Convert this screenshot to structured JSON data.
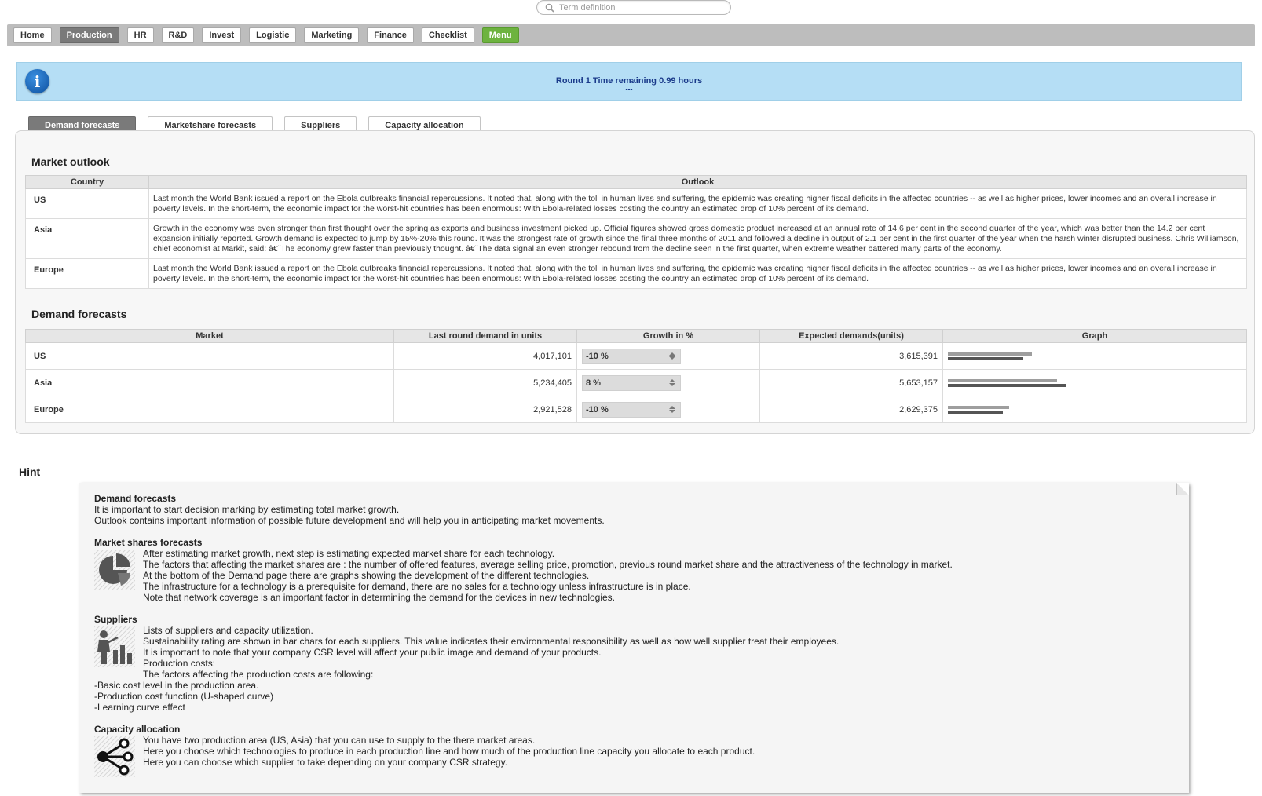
{
  "search": {
    "placeholder": "Term definition"
  },
  "nav": {
    "items": [
      "Home",
      "Production",
      "HR",
      "R&D",
      "Invest",
      "Logistic",
      "Marketing",
      "Finance",
      "Checklist",
      "Menu"
    ],
    "active": "Production"
  },
  "banner": {
    "text": "Round 1 Time remaining 0.99 hours",
    "sub": "---"
  },
  "tabs": [
    "Demand forecasts",
    "Marketshare forecasts",
    "Suppliers",
    "Capacity allocation"
  ],
  "outlook": {
    "title": "Market outlook",
    "headers": [
      "Country",
      "Outlook"
    ],
    "rows": [
      {
        "country": "US",
        "text": "Last month the World Bank issued a report on the Ebola outbreaks financial repercussions. It noted that, along with the toll in human lives and suffering, the epidemic was creating higher fiscal deficits in the affected countries -- as well as higher prices, lower incomes and an overall increase in poverty levels. In the short-term, the economic impact for the worst-hit countries has been enormous: With Ebola-related losses costing the country an estimated drop of 10% percent of its demand."
      },
      {
        "country": "Asia",
        "text": "Growth in the economy was even stronger than first thought over the spring as exports and business investment picked up. Official figures showed gross domestic product increased at an annual rate of 14.6 per cent in the second quarter of the year, which was better than the 14.2 per cent expansion initially reported. Growth demand is expected to jump by 15%-20% this round. It was the strongest rate of growth since the final three months of 2011 and followed a decline in output of 2.1 per cent in the first quarter of the year when the harsh winter disrupted business. Chris Williamson, chief economist at Markit, said: â€˜The economy grew faster than previously thought. â€˜The data signal an even stronger rebound from the decline seen in the first quarter, when extreme weather battered many parts of the economy."
      },
      {
        "country": "Europe",
        "text": "Last month the World Bank issued a report on the Ebola outbreaks financial repercussions. It noted that, along with the toll in human lives and suffering, the epidemic was creating higher fiscal deficits in the affected countries -- as well as higher prices, lower incomes and an overall increase in poverty levels. In the short-term, the economic impact for the worst-hit countries has been enormous: With Ebola-related losses costing the country an estimated drop of 10% percent of its demand."
      }
    ]
  },
  "demand": {
    "title": "Demand forecasts",
    "headers": [
      "Market",
      "Last round demand in units",
      "Growth in %",
      "Expected demands(units)",
      "Graph"
    ],
    "rows": [
      {
        "market": "US",
        "last": "4,017,101",
        "growth": "-10 %",
        "expected": "3,615,391",
        "last_value": 4017101,
        "expected_value": 3615391
      },
      {
        "market": "Asia",
        "last": "5,234,405",
        "growth": "8 %",
        "expected": "5,653,157",
        "last_value": 5234405,
        "expected_value": 5653157
      },
      {
        "market": "Europe",
        "last": "2,921,528",
        "growth": "-10 %",
        "expected": "2,629,375",
        "last_value": 2921528,
        "expected_value": 2629375
      }
    ]
  },
  "hint": {
    "title": "Hint",
    "sections": [
      {
        "head": "Demand forecasts",
        "icon": "",
        "lines": [
          "It is important to start decision marking by estimating total market growth.",
          "Outlook contains important information of possible future development and will help you in anticipating market movements."
        ]
      },
      {
        "head": "Market shares forecasts",
        "icon": "pie-chart-icon",
        "lines": [
          "After estimating market growth, next step is estimating expected market share for each technology.",
          "The factors that affecting the market shares are : the number of offered features, average selling price, promotion, previous round market share and the attractiveness of the technology in market.",
          "At the bottom of the Demand page there are graphs showing the development of the different technologies.",
          "The infrastructure for a technology is a prerequisite for demand, there are no sales for a technology unless infrastructure is in place.",
          "Note that network coverage is an important factor in determining the demand for the devices in new technologies."
        ]
      },
      {
        "head": "Suppliers",
        "icon": "presenter-chart-icon",
        "lines": [
          "Lists of suppliers and capacity utilization.",
          "Sustainability rating are shown in bar chars for each suppliers. This value indicates their environmental responsibility as well as how well supplier treat their employees.",
          "It is important to note that your company CSR level will affect your public image and demand of your products.",
          "Production costs:",
          "The factors affecting the production costs are following:"
        ],
        "extra": [
          "-Basic cost level in the production area.",
          "-Production cost function (U-shaped curve)",
          "-Learning curve effect"
        ]
      },
      {
        "head": "Capacity allocation",
        "icon": "share-network-icon",
        "lines": [
          "You have two production area (US, Asia) that you can use to supply to the there market areas.",
          "Here you choose which technologies to produce in each production line and how much of the production line capacity you allocate to each product.",
          "Here you can choose which supplier to take depending on your company CSR strategy."
        ]
      }
    ]
  }
}
